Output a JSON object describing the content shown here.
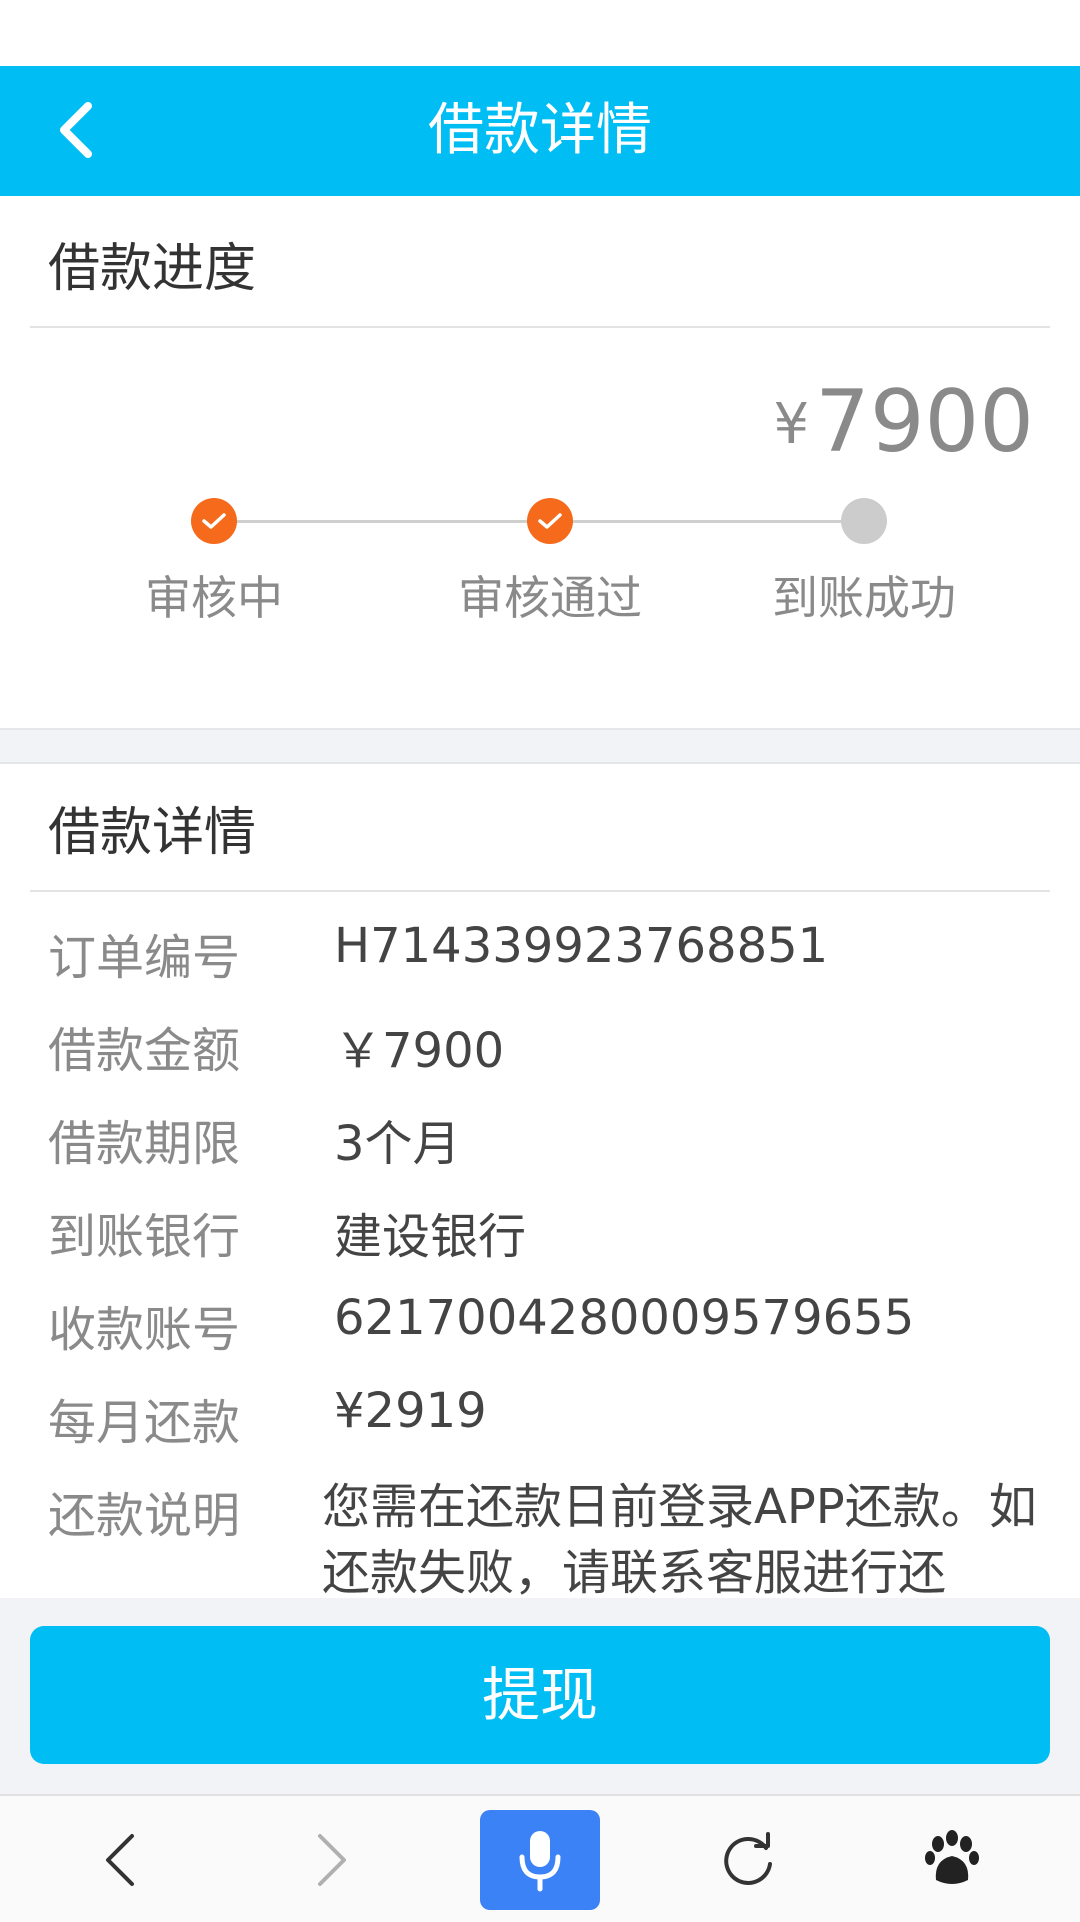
{
  "header": {
    "title": "借款详情",
    "back_icon": "chevron-left-icon"
  },
  "progress": {
    "title": "借款进度",
    "amount_currency": "¥",
    "amount": "7900",
    "steps": [
      {
        "label": "审核中",
        "status": "done"
      },
      {
        "label": "审核通过",
        "status": "done"
      },
      {
        "label": "到账成功",
        "status": "pending"
      }
    ]
  },
  "details": {
    "title": "借款详情",
    "rows": [
      {
        "label": "订单编号",
        "value": "H714339923768851"
      },
      {
        "label": "借款金额",
        "value": "￥7900"
      },
      {
        "label": "借款期限",
        "value": "3个月"
      },
      {
        "label": "到账银行",
        "value": "建设银行"
      },
      {
        "label": "收款账号",
        "value": "6217004280009579655"
      },
      {
        "label": "每月还款",
        "value": "¥2919"
      }
    ],
    "note_label": "还款说明",
    "note_text": "您需在还款日前登录APP还款。如还款失败，请联系客服进行还"
  },
  "action": {
    "withdraw_label": "提现"
  },
  "browser_nav": {
    "icons": [
      "back-arrow-icon",
      "forward-arrow-icon",
      "microphone-icon",
      "refresh-icon",
      "baidu-paw-icon"
    ]
  },
  "colors": {
    "primary": "#00bdf4",
    "step_done": "#f56a1b",
    "step_pending": "#cccccc",
    "mic_button": "#3b82f6"
  }
}
